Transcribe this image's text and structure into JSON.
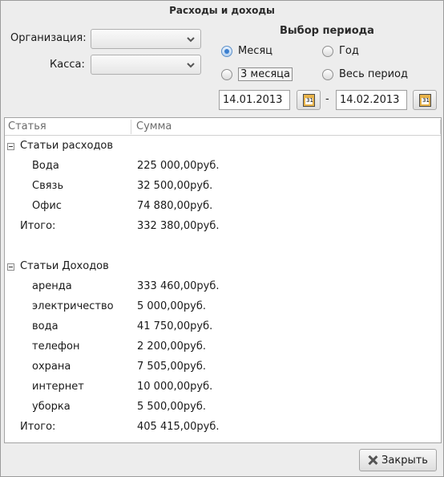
{
  "window": {
    "title": "Расходы и доходы"
  },
  "filters": {
    "organization_label": "Организация:",
    "organization_value": "",
    "cashbox_label": "Касса:",
    "cashbox_value": ""
  },
  "period": {
    "title": "Выбор периода",
    "options": [
      {
        "label": "Месяц",
        "checked": true
      },
      {
        "label": "Год",
        "checked": false
      },
      {
        "label": "3 месяца",
        "checked": false
      },
      {
        "label": "Весь период",
        "checked": false
      }
    ],
    "date_from": "14.01.2013",
    "date_separator": "-",
    "date_to": "14.02.2013",
    "calendar_icon_text": "31"
  },
  "table": {
    "columns": [
      "Статья",
      "Сумма"
    ],
    "expense_group": "Статьи расходов",
    "expenses": [
      {
        "name": "Вода",
        "amount": "225 000,00руб."
      },
      {
        "name": "Связь",
        "amount": "32 500,00руб."
      },
      {
        "name": "Офис",
        "amount": "74 880,00руб."
      }
    ],
    "expense_total_label": "Итого:",
    "expense_total": "332 380,00руб.",
    "income_group": "Статьи Доходов",
    "incomes": [
      {
        "name": "аренда",
        "amount": "333 460,00руб."
      },
      {
        "name": "электричество",
        "amount": "5 000,00руб."
      },
      {
        "name": "вода",
        "amount": "41 750,00руб."
      },
      {
        "name": "телефон",
        "amount": "2 200,00руб."
      },
      {
        "name": "охрана",
        "amount": "7 505,00руб."
      },
      {
        "name": "интернет",
        "amount": "10 000,00руб."
      },
      {
        "name": "уборка",
        "amount": "5 500,00руб."
      }
    ],
    "income_total_label": "Итого:",
    "income_total": "405 415,00руб."
  },
  "buttons": {
    "close_label": "Закрыть"
  },
  "colors": {
    "radio_accent": "#3b7fd0",
    "calendar_icon": "#e8b34a"
  }
}
